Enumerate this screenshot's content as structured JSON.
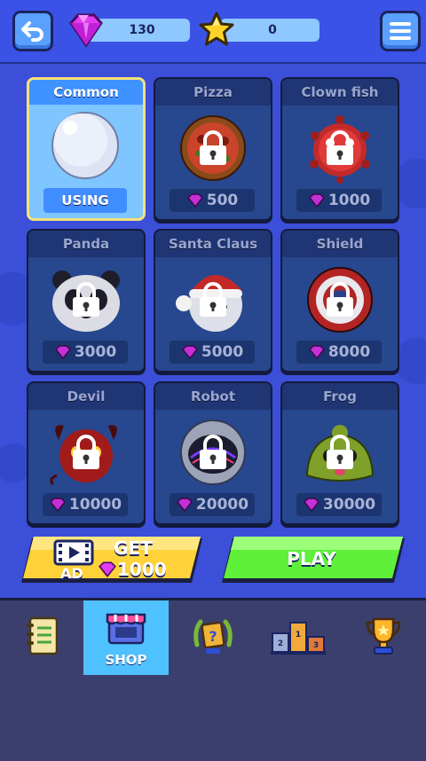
{
  "header": {
    "gems": "130",
    "stars": "0"
  },
  "skins": [
    {
      "name": "Common",
      "state": "using",
      "label": "USING"
    },
    {
      "name": "Pizza",
      "state": "locked",
      "price": "500"
    },
    {
      "name": "Clown fish",
      "state": "locked",
      "price": "1000"
    },
    {
      "name": "Panda",
      "state": "locked",
      "price": "3000"
    },
    {
      "name": "Santa Claus",
      "state": "locked",
      "price": "5000"
    },
    {
      "name": "Shield",
      "state": "locked",
      "price": "8000"
    },
    {
      "name": "Devil",
      "state": "locked",
      "price": "10000"
    },
    {
      "name": "Robot",
      "state": "locked",
      "price": "20000"
    },
    {
      "name": "Frog",
      "state": "locked",
      "price": "30000"
    }
  ],
  "actions": {
    "ad_top": "GET",
    "ad_amount": "1000",
    "ad_tag": "AD",
    "play": "PLAY"
  },
  "nav": {
    "shop": "SHOP"
  },
  "colors": {
    "background": "#3b4fd8",
    "card": "#27478f",
    "selected_card": "#7fc5ff",
    "ad_button": "#ffd23a",
    "play_button": "#5ff03a",
    "nav_active": "#4fc1ff"
  }
}
